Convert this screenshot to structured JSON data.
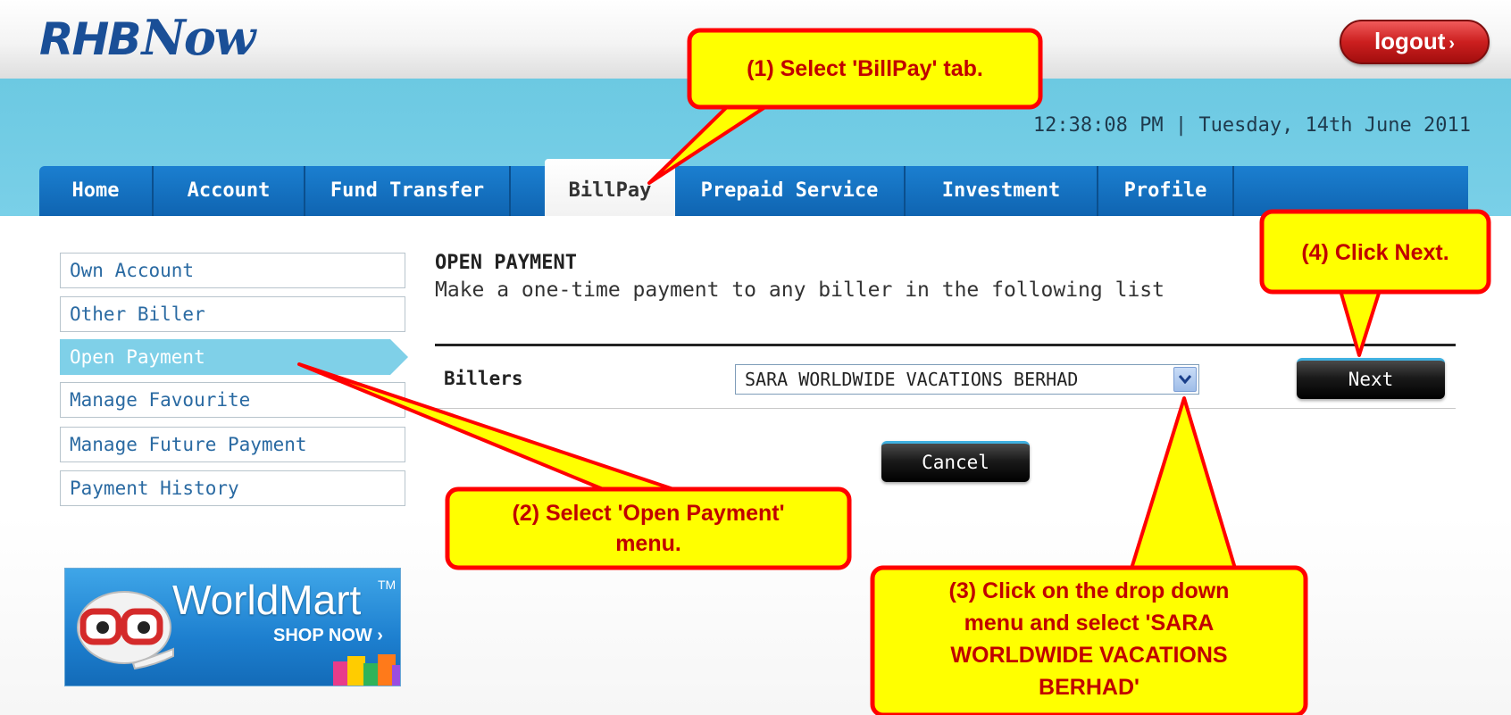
{
  "header": {
    "logo_part1": "RHB",
    "logo_part2": "Now",
    "logout_label": "logout",
    "logout_chevron": "›"
  },
  "datetime": "12:38:08 PM | Tuesday, 14th June 2011",
  "tabs": [
    {
      "label": "Home",
      "active": false
    },
    {
      "label": "Account",
      "active": false
    },
    {
      "label": "Fund Transfer",
      "active": false
    },
    {
      "label": "BillPay",
      "active": true
    },
    {
      "label": "Prepaid Service",
      "active": false
    },
    {
      "label": "Investment",
      "active": false
    },
    {
      "label": "Profile",
      "active": false
    }
  ],
  "sidebar": {
    "items": [
      {
        "label": "Own Account",
        "active": false
      },
      {
        "label": "Other Biller",
        "active": false
      },
      {
        "label": "Open Payment",
        "active": true
      },
      {
        "label": "Manage Favourite",
        "active": false
      },
      {
        "label": "Manage Future Payment",
        "active": false
      },
      {
        "label": "Payment History",
        "active": false
      }
    ]
  },
  "banner": {
    "title": "WorldMart",
    "trademark": "TM",
    "cta": "SHOP NOW ›"
  },
  "form": {
    "title": "OPEN PAYMENT",
    "description": "Make a one-time payment to any biller in the following list",
    "billers_label": "Billers",
    "billers_selected": "SARA WORLDWIDE VACATIONS BERHAD",
    "next_label": "Next",
    "cancel_label": "Cancel"
  },
  "callouts": {
    "step1": "(1)  Select 'BillPay' tab.",
    "step2_line1": "(2)  Select 'Open Payment'",
    "step2_line2": "menu.",
    "step3_line1": "(3)  Click on the drop down",
    "step3_line2": "menu and  select 'SARA",
    "step3_line3": "WORLDWIDE VACATIONS",
    "step3_line4": "BERHAD'",
    "step4": "(4)  Click Next."
  },
  "colors": {
    "brand_blue": "#1a4f97",
    "nav_blue": "#0f64b1",
    "band_cyan": "#7ad0e8",
    "callout_fill": "#ffff00",
    "callout_stroke": "#ff0000",
    "callout_text": "#c00000",
    "logout_red": "#cc1f1f"
  },
  "icons": {
    "logout": "chevron-right-icon",
    "dropdown": "chevron-down-icon",
    "banner_mascot": "mascot-icon",
    "banner_bags": "shopping-bags-icon"
  }
}
